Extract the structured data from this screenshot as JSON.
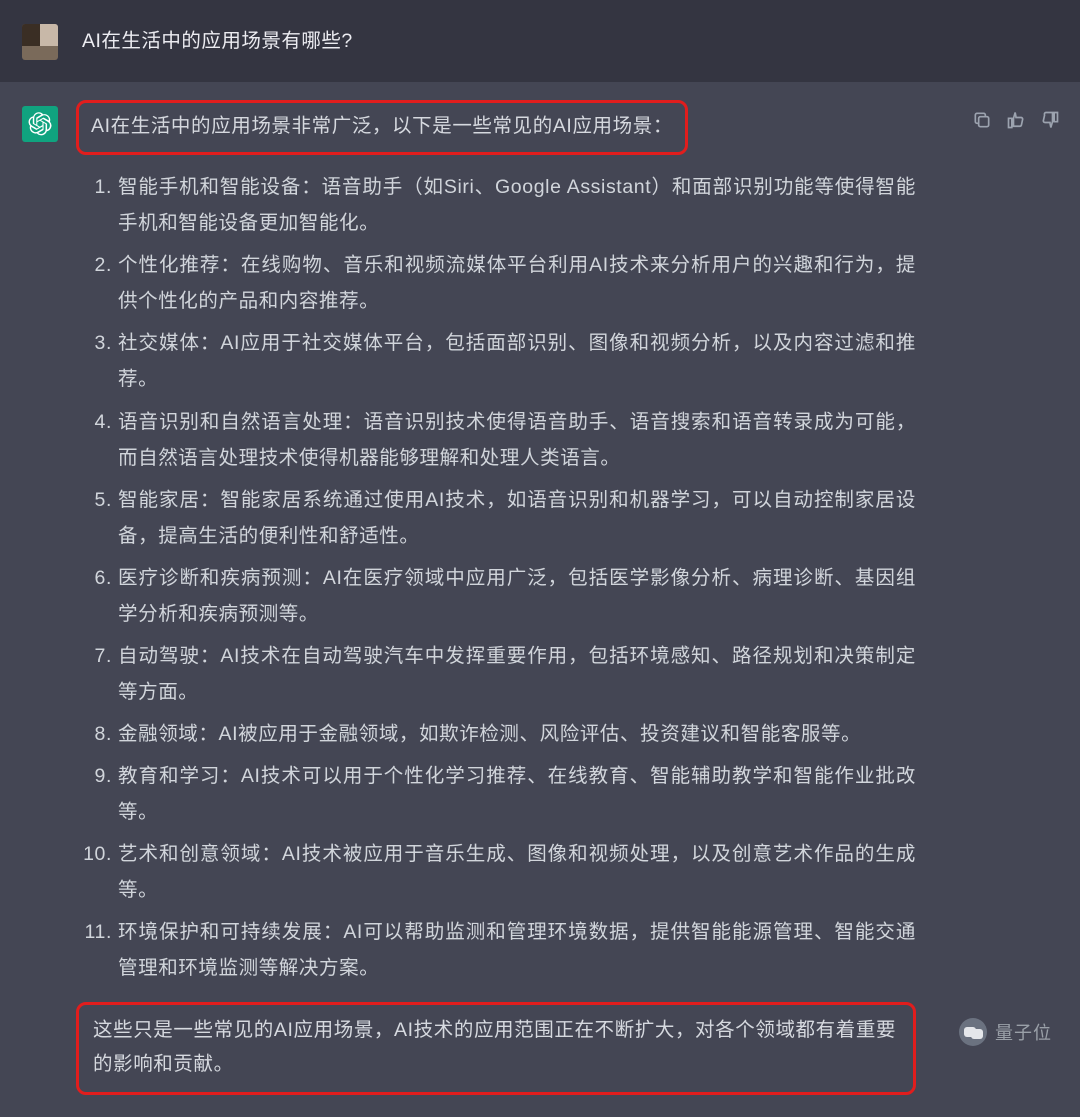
{
  "user": {
    "question": "AI在生活中的应用场景有哪些?"
  },
  "assistant": {
    "intro": "AI在生活中的应用场景非常广泛，以下是一些常见的AI应用场景：",
    "items": [
      "智能手机和智能设备：语音助手（如Siri、Google Assistant）和面部识别功能等使得智能手机和智能设备更加智能化。",
      "个性化推荐：在线购物、音乐和视频流媒体平台利用AI技术来分析用户的兴趣和行为，提供个性化的产品和内容推荐。",
      "社交媒体：AI应用于社交媒体平台，包括面部识别、图像和视频分析，以及内容过滤和推荐。",
      "语音识别和自然语言处理：语音识别技术使得语音助手、语音搜索和语音转录成为可能，而自然语言处理技术使得机器能够理解和处理人类语言。",
      "智能家居：智能家居系统通过使用AI技术，如语音识别和机器学习，可以自动控制家居设备，提高生活的便利性和舒适性。",
      "医疗诊断和疾病预测：AI在医疗领域中应用广泛，包括医学影像分析、病理诊断、基因组学分析和疾病预测等。",
      "自动驾驶：AI技术在自动驾驶汽车中发挥重要作用，包括环境感知、路径规划和决策制定等方面。",
      "金融领域：AI被应用于金融领域，如欺诈检测、风险评估、投资建议和智能客服等。",
      "教育和学习：AI技术可以用于个性化学习推荐、在线教育、智能辅助教学和智能作业批改等。",
      "艺术和创意领域：AI技术被应用于音乐生成、图像和视频处理，以及创意艺术作品的生成等。",
      "环境保护和可持续发展：AI可以帮助监测和管理环境数据，提供智能能源管理、智能交通管理和环境监测等解决方案。"
    ],
    "outro": "这些只是一些常见的AI应用场景，AI技术的应用范围正在不断扩大，对各个领域都有着重要的影响和贡献。"
  },
  "watermark": "量子位",
  "icons": {
    "copy": "copy-icon",
    "like": "thumbs-up-icon",
    "dislike": "thumbs-down-icon",
    "logo": "openai-logo-icon"
  }
}
